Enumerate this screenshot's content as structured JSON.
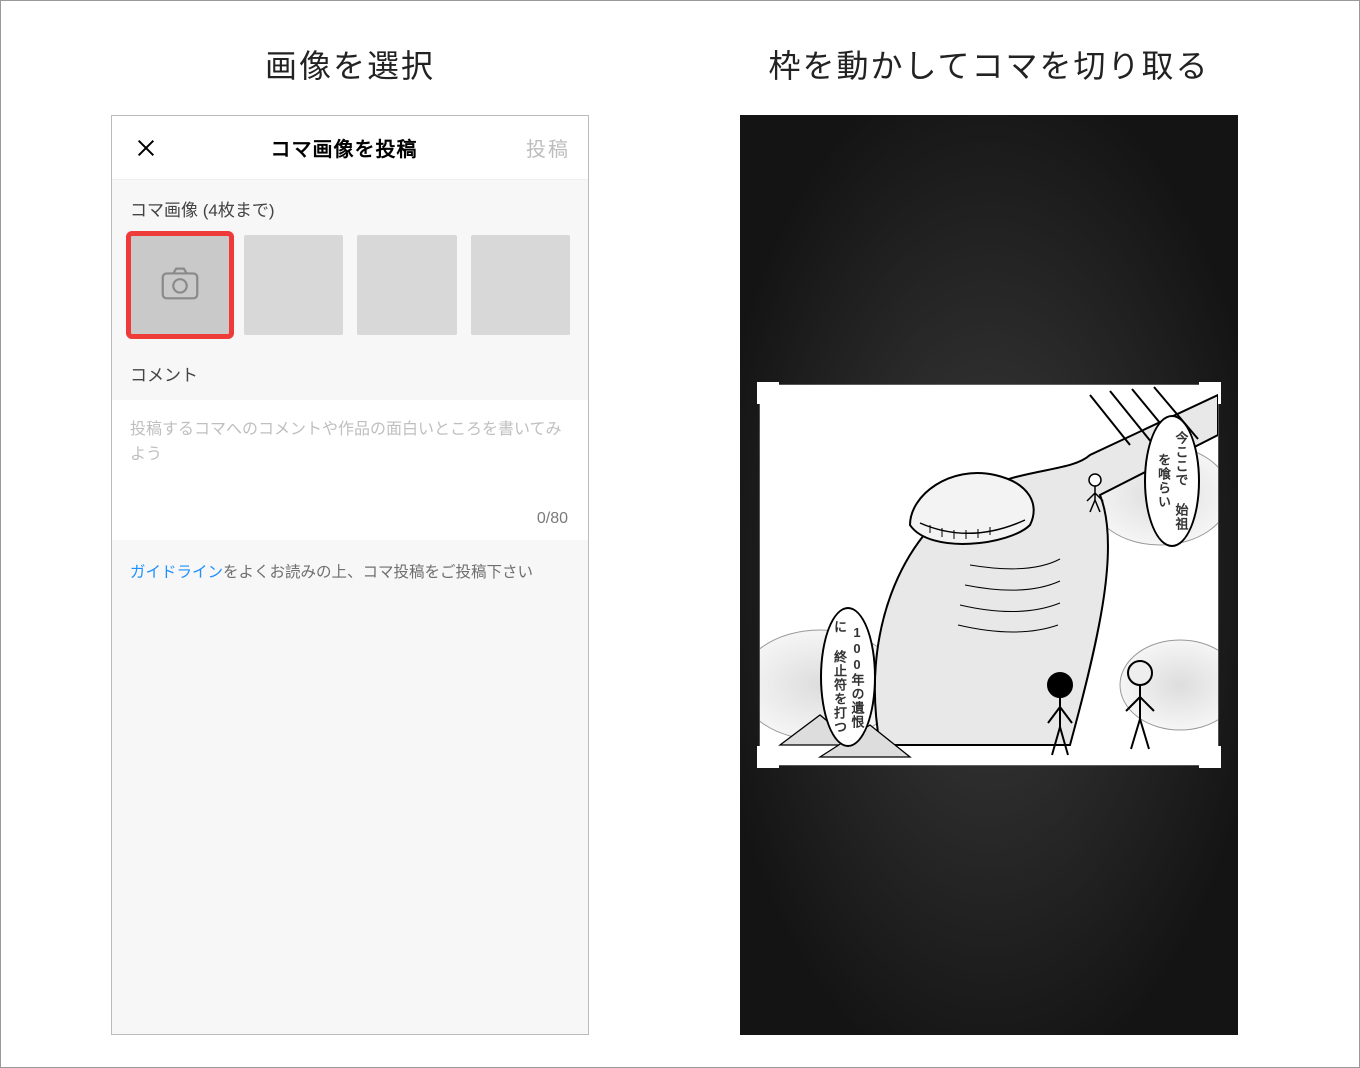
{
  "left": {
    "title": "画像を選択",
    "header": {
      "close_icon": "close-icon",
      "screen_title": "コマ画像を投稿",
      "post_label": "投稿"
    },
    "images_section": {
      "label": "コマ画像 (4枚まで)",
      "slot_count": 4,
      "selected_index": 0
    },
    "comment_section": {
      "label": "コメント",
      "placeholder": "投稿するコマへのコメントや作品の面白いところを書いてみよう",
      "counter": "0/80"
    },
    "guideline": {
      "link_text": "ガイドライン",
      "rest_text": "をよくお読みの上、コマ投稿をご投稿下さい"
    }
  },
  "right": {
    "title": "枠を動かしてコマを切り取る",
    "speech1": "今ここで\n始祖を喰らい",
    "speech2": "100年の遺恨に\n終止符を打つ"
  }
}
